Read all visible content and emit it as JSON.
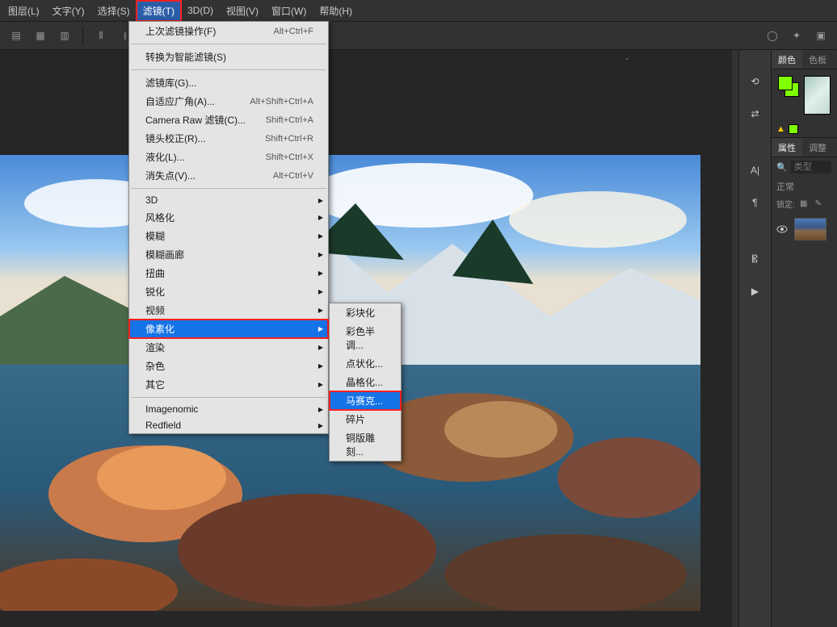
{
  "menubar": {
    "items": [
      "图层(L)",
      "文字(Y)",
      "选择(S)",
      "滤镜(T)",
      "3D(D)",
      "视图(V)",
      "窗口(W)",
      "帮助(H)"
    ],
    "active_index": 3
  },
  "dropdown": {
    "last_filter": {
      "label": "上次滤镜操作(F)",
      "shortcut": "Alt+Ctrl+F"
    },
    "convert_smart": {
      "label": "转换为智能滤镜(S)"
    },
    "group2": [
      {
        "label": "滤镜库(G)...",
        "shortcut": ""
      },
      {
        "label": "自适应广角(A)...",
        "shortcut": "Alt+Shift+Ctrl+A"
      },
      {
        "label": "Camera Raw 滤镜(C)...",
        "shortcut": "Shift+Ctrl+A"
      },
      {
        "label": "镜头校正(R)...",
        "shortcut": "Shift+Ctrl+R"
      },
      {
        "label": "液化(L)...",
        "shortcut": "Shift+Ctrl+X"
      },
      {
        "label": "消失点(V)...",
        "shortcut": "Alt+Ctrl+V"
      }
    ],
    "group3": [
      {
        "label": "3D",
        "arrow": true
      },
      {
        "label": "风格化",
        "arrow": true
      },
      {
        "label": "模糊",
        "arrow": true
      },
      {
        "label": "模糊画廊",
        "arrow": true
      },
      {
        "label": "扭曲",
        "arrow": true
      },
      {
        "label": "锐化",
        "arrow": true
      },
      {
        "label": "视频",
        "arrow": true
      },
      {
        "label": "像素化",
        "arrow": true,
        "selected": true,
        "highlight": true
      },
      {
        "label": "渲染",
        "arrow": true
      },
      {
        "label": "杂色",
        "arrow": true
      },
      {
        "label": "其它",
        "arrow": true
      }
    ],
    "group4": [
      {
        "label": "Imagenomic",
        "arrow": true
      },
      {
        "label": "Redfield",
        "arrow": true
      }
    ]
  },
  "submenu": {
    "items": [
      {
        "label": "彩块化"
      },
      {
        "label": "彩色半调..."
      },
      {
        "label": "点状化..."
      },
      {
        "label": "晶格化..."
      },
      {
        "label": "马赛克...",
        "selected": true,
        "highlight": true
      },
      {
        "label": "碎片"
      },
      {
        "label": "铜版雕刻..."
      }
    ]
  },
  "right_panel": {
    "tabs1": [
      "颜色",
      "色板"
    ],
    "tabs2": [
      "属性",
      "调整"
    ],
    "search_placeholder": "类型",
    "blend_mode": "正常",
    "lock_label": "锁定:"
  }
}
